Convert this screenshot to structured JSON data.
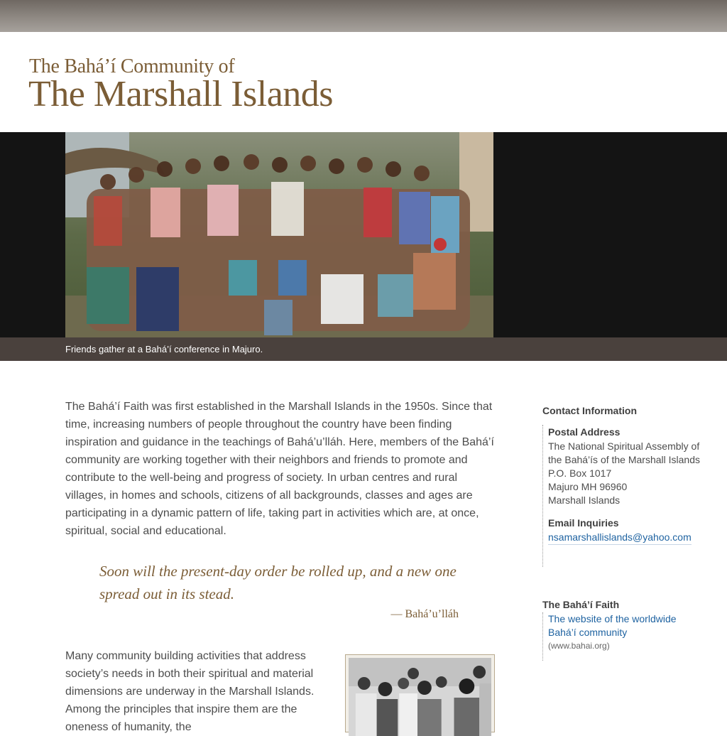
{
  "header": {
    "subtitle": "The Bahá’í Community of",
    "title": "The Marshall Islands"
  },
  "hero": {
    "caption": "Friends gather at a Bahá’í conference in Majuro."
  },
  "main": {
    "intro": "The Bahá’í Faith was first established in the Marshall Islands in the 1950s. Since that time, increasing numbers of people throughout the country have been finding inspiration and guidance in the teachings of Bahá’u’lláh. Here, members of the Bahá’í community are working together with their neighbors and friends to promote and contribute to the well-being and progress of society. In urban centres and rural villages, in homes and schools, citizens of all backgrounds, classes and ages are participating in a dynamic pattern of life, taking part in activities which are, at once, spiritual, social and educational.",
    "quote": "Soon will the present-day order be rolled up, and a new one spread out in its stead.",
    "quote_attribution": "— Bahá’u’lláh",
    "body2": "Many community building activities that address society’s needs in both their spiritual and material dimensions are underway in the Marshall Islands. Among the principles that inspire them are the oneness of humanity, the"
  },
  "sidebar": {
    "contact_heading": "Contact Information",
    "postal_label": "Postal Address",
    "address_lines": [
      "The National Spiritual Assembly of",
      "the Bahá’ís of the Marshall Islands",
      "P.O. Box 1017",
      "Majuro MH 96960",
      "Marshall Islands"
    ],
    "email_label": "Email Inquiries",
    "email": "nsamarshallislands@yahoo.com",
    "faith_heading": "The Bahá’í Faith",
    "faith_link_line1": "The website of the worldwide",
    "faith_link_line2": "Bahá’í community",
    "faith_url": "(www.bahai.org)"
  },
  "colors": {
    "title_brown": "#7b5d36",
    "caption_bar": "#4a413d",
    "hero_band": "#141414",
    "link_blue": "#1f63a1"
  },
  "images": {
    "hero_photo": "group-photo-color",
    "secondary_photo": "group-photo-bw"
  }
}
